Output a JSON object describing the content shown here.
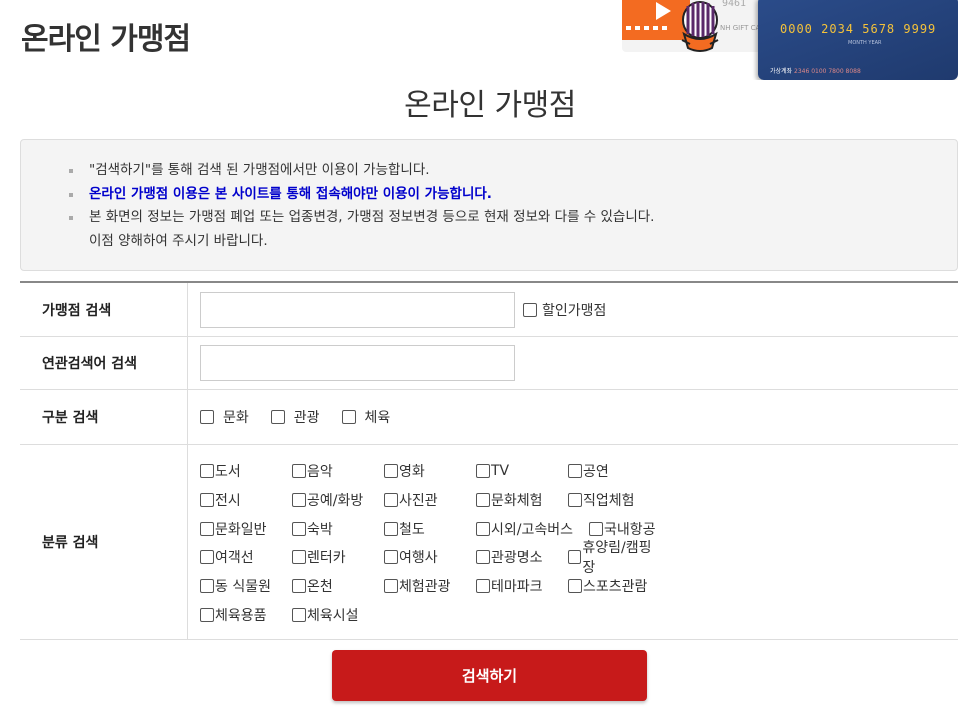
{
  "header": {
    "title": "온라인 가맹점"
  },
  "banner": {
    "gift_number": "9461",
    "gift_label": "NH GIFT CA",
    "card_number": "0000 2034 5678 9999",
    "card_small": "MONTH YEAR",
    "card_bottom_label": "가상계좌",
    "card_bottom_number": "2346 0100 7800 8088"
  },
  "page": {
    "heading": "온라인 가맹점"
  },
  "notice": {
    "lines": [
      "\"검색하기\"를 통해 검색 된 가맹점에서만 이용이 가능합니다.",
      "온라인 가맹점 이용은 본 사이트를 통해 접속해야만 이용이 가능합니다.",
      "본 화면의 정보는 가맹점 폐업 또는 업종변경, 가맹점 정보변경 등으로 현재 정보와 다를 수 있습니다.",
      "이점 양해하여 주시기 바랍니다."
    ]
  },
  "form": {
    "store_search": {
      "label": "가맹점 검색",
      "value": "",
      "discount_label": "할인가맹점"
    },
    "related_search": {
      "label": "연관검색어 검색",
      "value": ""
    },
    "type_search": {
      "label": "구분 검색",
      "options": [
        "문화",
        "관광",
        "체육"
      ]
    },
    "category_search": {
      "label": "분류 검색",
      "rows": [
        [
          "도서",
          "음악",
          "영화",
          "TV",
          "공연"
        ],
        [
          "전시",
          "공예/화방",
          "사진관",
          "문화체험",
          "직업체험"
        ],
        [
          "문화일반",
          "숙박",
          "철도",
          "시외/고속버스",
          "국내항공"
        ],
        [
          "여객선",
          "렌터카",
          "여행사",
          "관광명소",
          "휴양림/캠핑장"
        ],
        [
          "동 식물원",
          "온천",
          "체험관광",
          "테마파크",
          "스포츠관람"
        ],
        [
          "체육용품",
          "체육시설"
        ]
      ]
    }
  },
  "search_button": {
    "label": "검색하기"
  },
  "colors": {
    "accent": "#c71a1a",
    "emphasis_text": "#0000cc",
    "notice_bg": "#f4f4f4"
  }
}
